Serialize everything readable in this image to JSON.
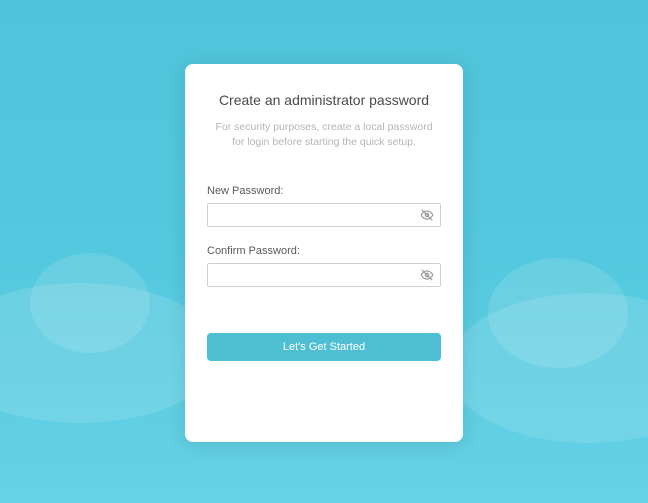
{
  "card": {
    "title": "Create an administrator password",
    "subtitle": "For security purposes, create a local password for login before starting the quick setup.",
    "fields": {
      "new_password": {
        "label": "New Password:",
        "value": ""
      },
      "confirm_password": {
        "label": "Confirm Password:",
        "value": ""
      }
    },
    "submit_label": "Let's Get Started"
  },
  "colors": {
    "accent": "#4ebfd3",
    "bg_start": "#4fc3d9",
    "bg_end": "#66d2e6"
  }
}
